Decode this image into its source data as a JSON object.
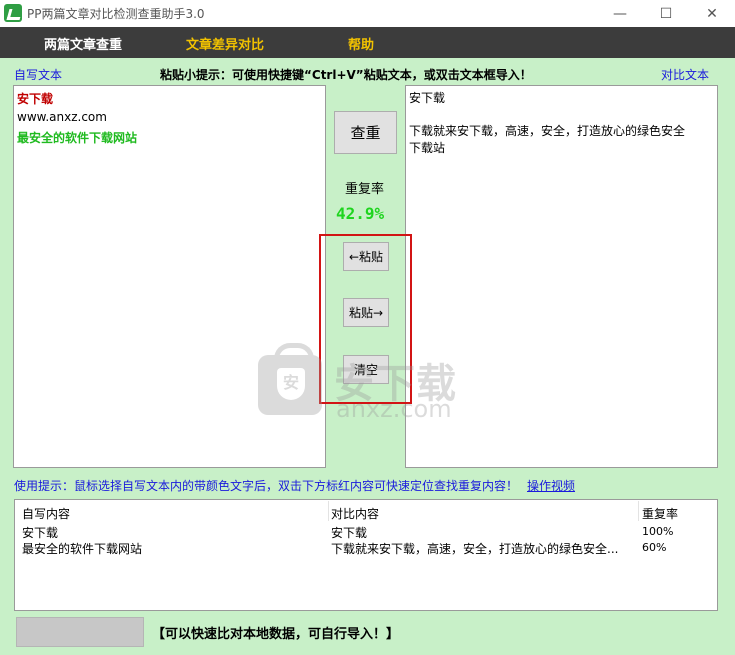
{
  "window": {
    "title": "PP两篇文章对比检测查重助手3.0",
    "minimize_glyph": "—",
    "maximize_glyph": "☐",
    "close_glyph": "✕"
  },
  "menu": {
    "items": [
      "两篇文章查重",
      "文章差异对比",
      "帮助"
    ],
    "active_index": 1
  },
  "labels": {
    "self_text": "自写文本",
    "compare_text": "对比文本",
    "paste_hint": "粘贴小提示：可使用快捷键“Ctrl+V”粘贴文本，或双击文本框导入！"
  },
  "left_text": {
    "lines": [
      "安下载",
      "www.anxz.com",
      "最安全的软件下载网站"
    ]
  },
  "right_text": {
    "lines": [
      "安下载",
      "",
      "下载就来安下载，高速，安全，打造放心的绿色安全",
      "下载站"
    ]
  },
  "controls": {
    "check_label": "查重",
    "rate_label": "重复率",
    "rate_value": "42.9%",
    "paste_left_label": "←粘贴",
    "paste_right_label": "粘贴→",
    "clear_label": "清空"
  },
  "usage": {
    "hint": "使用提示：鼠标选择自写文本内的带颜色文字后，双击下方标红内容可快速定位查找重复内容！",
    "video_link": "操作视频"
  },
  "table": {
    "headers": [
      "自写内容",
      "对比内容",
      "重复率"
    ],
    "rows": [
      [
        "安下载",
        "安下载",
        "100%"
      ],
      [
        "最安全的软件下载网站",
        "下载就来安下载，高速，安全，打造放心的绿色安全...",
        "60%"
      ]
    ]
  },
  "footer": {
    "note": "【可以快速比对本地数据，可自行导入！】"
  },
  "watermark": {
    "text_cn": "安下载",
    "text_en": "anxz.com",
    "shield_glyph": "安"
  },
  "colors": {
    "menubar": "#3c3c3c",
    "menu_active": "#f2c200",
    "panel": "#c8f0c8",
    "highlight_red": "#c00000",
    "highlight_green": "#1fba1f",
    "rate": "#1fd51f",
    "frame": "#d21414",
    "link_blue": "#1a1adc"
  }
}
